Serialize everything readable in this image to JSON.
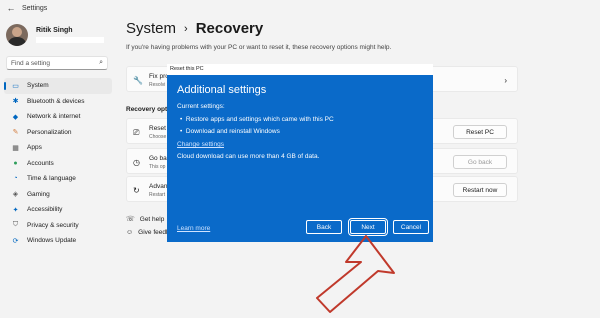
{
  "titlebar": {
    "back_glyph": "←",
    "title": "Settings"
  },
  "profile": {
    "name": "Ritik Singh"
  },
  "search": {
    "placeholder": "Find a setting"
  },
  "sidebar": {
    "items": [
      {
        "label": "System",
        "icon": "monitor-icon",
        "glyph": "▭",
        "color": "#0067c0",
        "active": true
      },
      {
        "label": "Bluetooth & devices",
        "icon": "bluetooth-icon",
        "glyph": "✱",
        "color": "#0067c0"
      },
      {
        "label": "Network & internet",
        "icon": "network-icon",
        "glyph": "◆",
        "color": "#0067c0"
      },
      {
        "label": "Personalization",
        "icon": "brush-icon",
        "glyph": "✎",
        "color": "#d3793a"
      },
      {
        "label": "Apps",
        "icon": "apps-icon",
        "glyph": "▦",
        "color": "#555555"
      },
      {
        "label": "Accounts",
        "icon": "person-icon",
        "glyph": "●",
        "color": "#2e9e5b"
      },
      {
        "label": "Time & language",
        "icon": "clock-globe-icon",
        "glyph": "◔",
        "color": "#0067c0"
      },
      {
        "label": "Gaming",
        "icon": "gamepad-icon",
        "glyph": "◈",
        "color": "#555555"
      },
      {
        "label": "Accessibility",
        "icon": "accessibility-icon",
        "glyph": "✦",
        "color": "#0067c0"
      },
      {
        "label": "Privacy & security",
        "icon": "shield-icon",
        "glyph": "⛉",
        "color": "#555555"
      },
      {
        "label": "Windows Update",
        "icon": "update-icon",
        "glyph": "⟳",
        "color": "#0067c0"
      }
    ]
  },
  "header": {
    "parent": "System",
    "separator": "›",
    "current": "Recovery"
  },
  "subtitle": "If you're having problems with your PC or want to reset it, these recovery options might help.",
  "fix_card": {
    "title": "Fix pro",
    "sub": "Resolvi",
    "icon": "wrench-icon",
    "glyph": "🔧",
    "chevron": "›"
  },
  "recovery_label": "Recovery optio",
  "options": [
    {
      "title": "Reset",
      "sub": "Choose",
      "icon": "reset-pc-icon",
      "glyph": "⎚",
      "button": "Reset PC",
      "disabled": false
    },
    {
      "title": "Go ba",
      "sub": "This op",
      "icon": "history-icon",
      "glyph": "◷",
      "button": "Go back",
      "disabled": true
    },
    {
      "title": "Advan",
      "sub": "Restart",
      "icon": "advanced-startup-icon",
      "glyph": "↻",
      "button": "Restart now",
      "disabled": false
    }
  ],
  "help_links": [
    {
      "label": "Get help",
      "icon": "help-icon",
      "glyph": "☏"
    },
    {
      "label": "Give feedb",
      "icon": "feedback-icon",
      "glyph": "☺"
    }
  ],
  "dialog": {
    "window_title": "Reset this PC",
    "heading": "Additional settings",
    "current_label": "Current settings:",
    "bullets": [
      "Restore apps and settings which came with this PC",
      "Download and reinstall Windows"
    ],
    "change_link": "Change settings",
    "note": "Cloud download can use more than 4 GB of data.",
    "learn_more": "Learn more",
    "buttons": {
      "back": "Back",
      "next": "Next",
      "cancel": "Cancel"
    }
  },
  "colors": {
    "accent": "#0067c0",
    "dialog_bg": "#0a6ac9",
    "arrow_stroke": "#c0392b"
  }
}
